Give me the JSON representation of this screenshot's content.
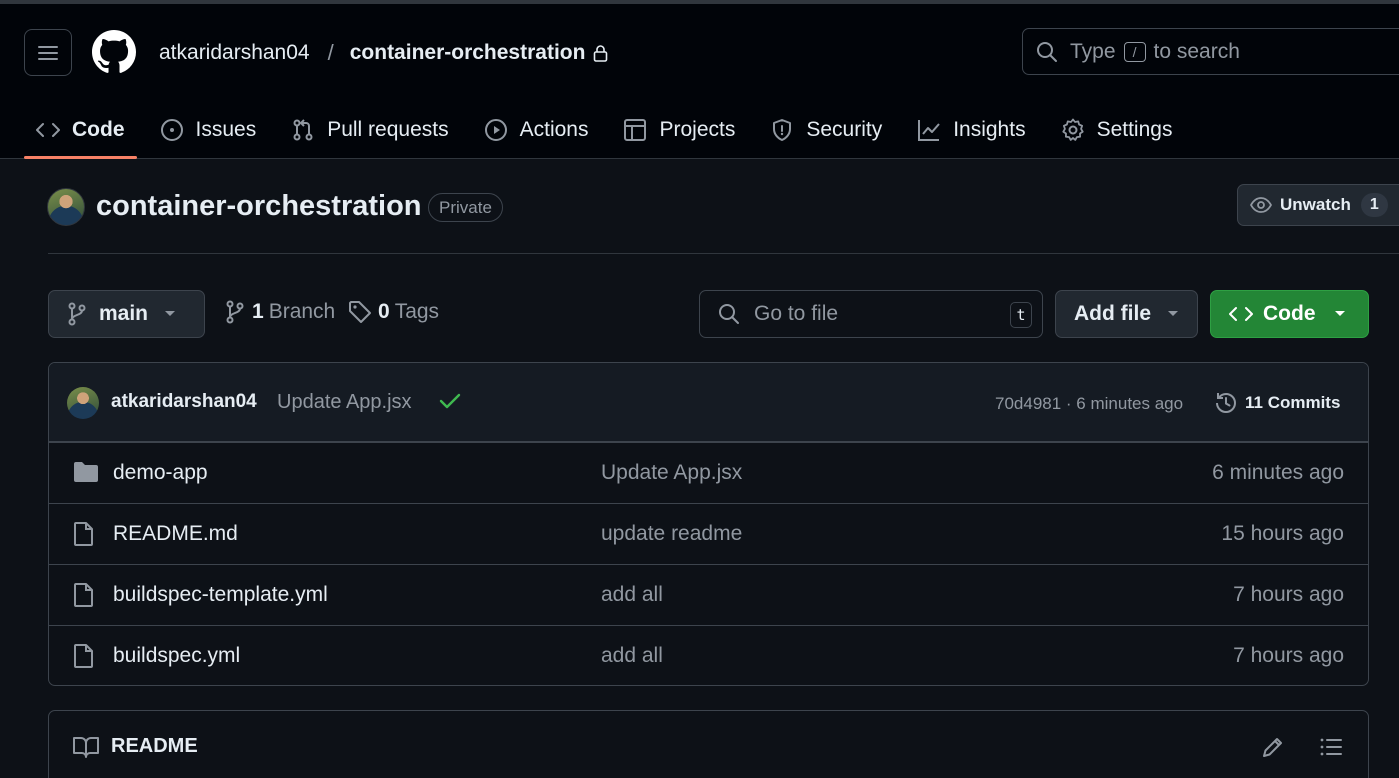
{
  "header": {
    "owner": "atkaridarshan04",
    "separator": "/",
    "repo": "container-orchestration",
    "search": {
      "prefix": "Type",
      "key": "/",
      "suffix": "to search"
    }
  },
  "tabs": [
    {
      "label": "Code",
      "icon": "code-icon",
      "selected": true
    },
    {
      "label": "Issues",
      "icon": "issue-icon"
    },
    {
      "label": "Pull requests",
      "icon": "pull-request-icon"
    },
    {
      "label": "Actions",
      "icon": "play-icon"
    },
    {
      "label": "Projects",
      "icon": "table-icon"
    },
    {
      "label": "Security",
      "icon": "shield-icon"
    },
    {
      "label": "Insights",
      "icon": "graph-icon"
    },
    {
      "label": "Settings",
      "icon": "gear-icon"
    }
  ],
  "repo_title": {
    "name": "container-orchestration",
    "visibility": "Private",
    "watch_label": "Unwatch",
    "watch_count": "1"
  },
  "toolbar": {
    "branch": "main",
    "branches_count": "1",
    "branches_label": "Branch",
    "tags_count": "0",
    "tags_label": "Tags",
    "goto_placeholder": "Go to file",
    "goto_key": "t",
    "add_file": "Add file",
    "code": "Code"
  },
  "latest_commit": {
    "author": "atkaridarshan04",
    "message": "Update App.jsx",
    "hash_time": "70d4981 · 6 minutes ago",
    "commits": "11 Commits"
  },
  "files": [
    {
      "name": "demo-app",
      "type": "folder",
      "message": "Update App.jsx",
      "time": "6 minutes ago"
    },
    {
      "name": "README.md",
      "type": "file",
      "message": "update readme",
      "time": "15 hours ago"
    },
    {
      "name": "buildspec-template.yml",
      "type": "file",
      "message": "add all",
      "time": "7 hours ago"
    },
    {
      "name": "buildspec.yml",
      "type": "file",
      "message": "add all",
      "time": "7 hours ago"
    }
  ],
  "readme": {
    "title": "README"
  },
  "colors": {
    "accent_green": "#238636",
    "tab_underline": "#f78166",
    "background": "#0d1117",
    "header_bg": "#010409"
  }
}
